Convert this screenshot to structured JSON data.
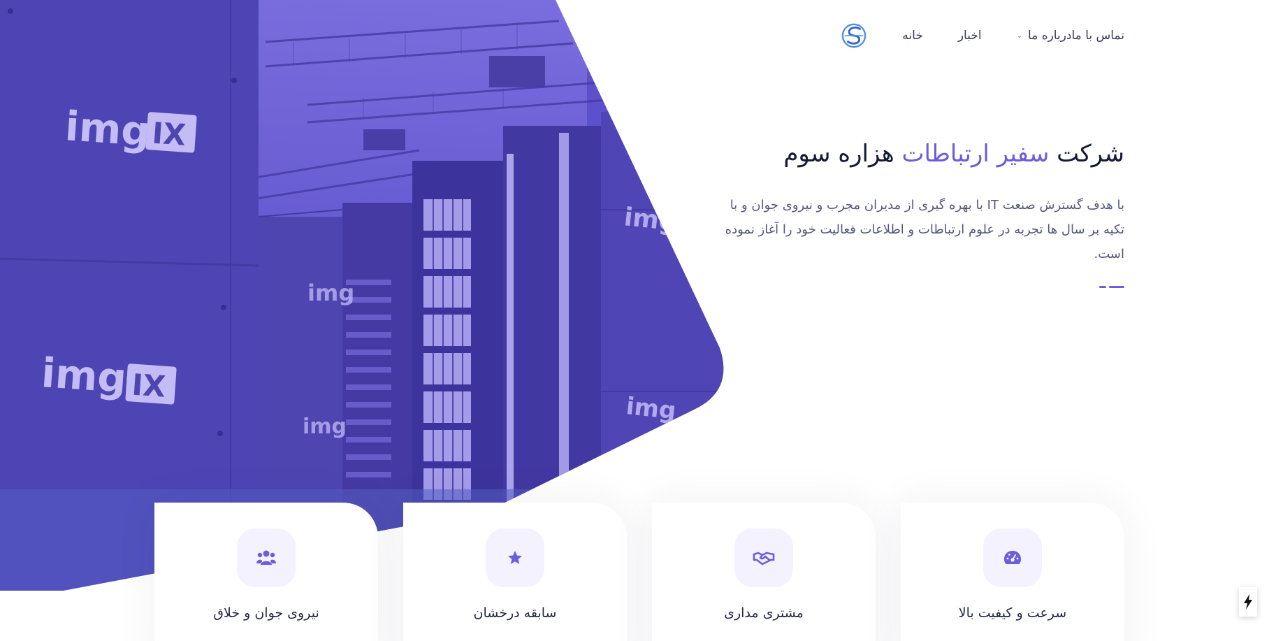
{
  "nav": {
    "items": [
      {
        "label": "خانه"
      },
      {
        "label": "اخبار"
      },
      {
        "label": "درباره ما"
      },
      {
        "label": "تماس با ما"
      }
    ]
  },
  "hero": {
    "title_part1": "شرکت",
    "title_accent": "سفیر ارتباطات",
    "title_part2": "هزاره سوم",
    "description": "با هدف گسترش صنعت IT با بهره گیری از مدیران مجرب و نیروی جوان و با تکیه بر سال ها تجربه در علوم ارتباطات و اطلاعات فعالیت خود را آغاز نموده است.",
    "image_watermarks": [
      "img",
      "IX"
    ]
  },
  "features": [
    {
      "title": "سرعت و کیفیت بالا",
      "icon": "speedometer-icon"
    },
    {
      "title": "مشتری مداری",
      "icon": "handshake-icon"
    },
    {
      "title": "سابقه درخشان",
      "icon": "star-icon"
    },
    {
      "title": "نیروی جوان و خلاق",
      "icon": "users-icon"
    }
  ],
  "colors": {
    "accent": "#6b5ddc",
    "heading": "#141a33",
    "text": "#53587a",
    "icon_bg": "#f4f2ff"
  }
}
